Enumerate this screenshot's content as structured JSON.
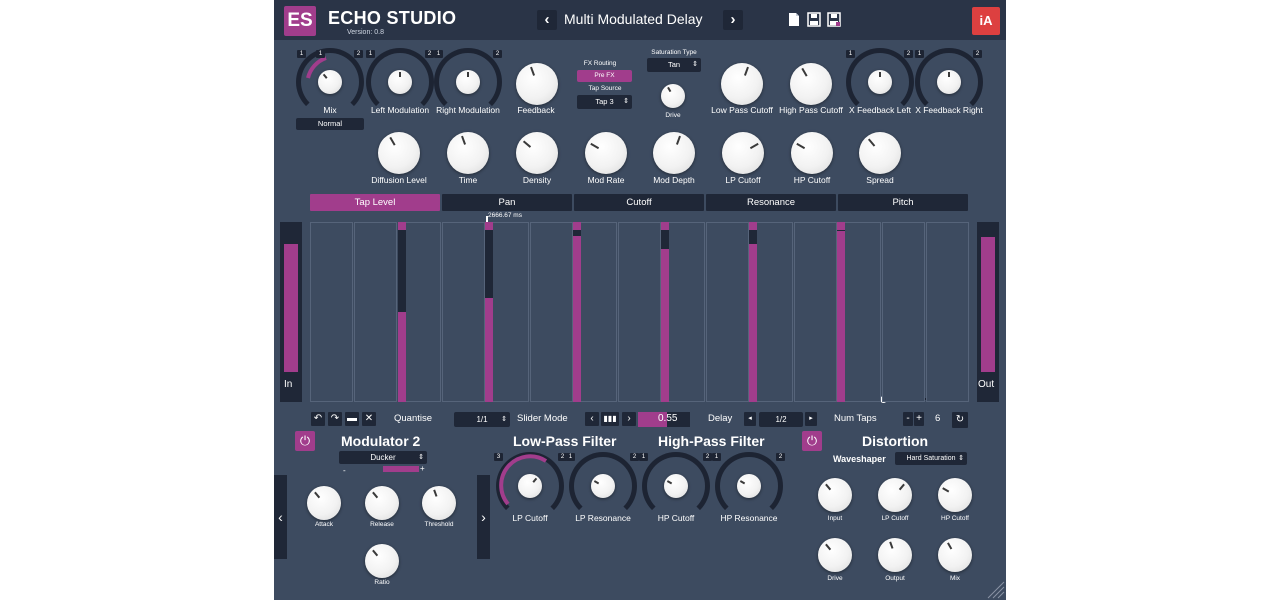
{
  "header": {
    "logo": "ES",
    "title": "ECHO STUDIO",
    "version": "Version: 0.8",
    "preset_name": "Multi Modulated Delay",
    "prev_arrow": "‹",
    "next_arrow": "›",
    "brand": "iA",
    "icons": [
      "new-file-icon",
      "save-icon",
      "save-as-icon"
    ]
  },
  "top_knobs": {
    "mix": {
      "label": "Mix",
      "mode": "Normal",
      "ring_left": "1",
      "ring_mid": "1",
      "ring_right": "2"
    },
    "left_mod": {
      "label": "Left Modulation",
      "ring_left": "1",
      "ring_right": "2"
    },
    "right_mod": {
      "label": "Right Modulation",
      "ring_left": "1",
      "ring_right": "2"
    },
    "feedback": {
      "label": "Feedback"
    },
    "fx_routing": {
      "label": "FX Routing",
      "value": "Pre FX"
    },
    "tap_source": {
      "label": "Tap Source",
      "value": "Tap 3"
    },
    "saturation_type": {
      "label": "Saturation Type",
      "value": "Tan"
    },
    "drive": {
      "label": "Drive"
    },
    "low_pass": {
      "label": "Low Pass Cutoff"
    },
    "high_pass": {
      "label": "High Pass Cutoff"
    },
    "x_fb_left": {
      "label": "X Feedback Left",
      "ring_left": "1",
      "ring_right": "2"
    },
    "x_fb_right": {
      "label": "X Feedback Right",
      "ring_left": "1",
      "ring_right": "2"
    }
  },
  "second_knobs": [
    {
      "label": "Diffusion Level"
    },
    {
      "label": "Time"
    },
    {
      "label": "Density"
    },
    {
      "label": "Mod Rate"
    },
    {
      "label": "Mod Depth"
    },
    {
      "label": "LP Cutoff"
    },
    {
      "label": "HP Cutoff"
    },
    {
      "label": "Spread"
    }
  ],
  "tabs": [
    "Tap Level",
    "Pan",
    "Cutoff",
    "Resonance",
    "Pitch"
  ],
  "active_tab": "Tap Level",
  "grid": {
    "time_readout": "2666.67 ms",
    "in_label": "In",
    "out_label": "Out",
    "in_level": 0.85,
    "out_level": 0.9,
    "taps": [
      {
        "level": 0.5,
        "top_dark": 0.49
      },
      {
        "level": 0.58,
        "top_dark": 0.41
      },
      {
        "level": 0.92,
        "top_dark": 0.07
      },
      {
        "level": 0.85,
        "top_dark": 0.14
      },
      {
        "level": 0.88,
        "top_dark": 0.11
      },
      {
        "level": 0.95,
        "top_dark": 0.04
      }
    ]
  },
  "controls": {
    "quantise_label": "Quantise",
    "quantise_value": "1/1",
    "slider_mode_label": "Slider Mode",
    "slider_value": "0.55",
    "delay_label": "Delay",
    "delay_value": "1/2",
    "num_taps_label": "Num Taps",
    "num_taps_value": "6",
    "minus": "-",
    "plus": "+"
  },
  "modulator": {
    "title": "Modulator 2",
    "mode": "Ducker",
    "knobs": [
      {
        "label": "Attack"
      },
      {
        "label": "Release"
      },
      {
        "label": "Threshold"
      },
      {
        "label": "Ratio"
      }
    ]
  },
  "filters": {
    "lp_title": "Low-Pass Filter",
    "hp_title": "High-Pass Filter",
    "knobs": [
      {
        "label": "LP Cutoff",
        "ring_left": "3",
        "ring_right": "2"
      },
      {
        "label": "LP Resonance",
        "ring_left": "1",
        "ring_right": "2"
      },
      {
        "label": "HP Cutoff",
        "ring_left": "1",
        "ring_right": "2"
      },
      {
        "label": "HP Resonance",
        "ring_left": "1",
        "ring_right": "2"
      }
    ]
  },
  "distortion": {
    "title": "Distortion",
    "waveshaper_label": "Waveshaper",
    "waveshaper_value": "Hard Saturation",
    "knobs": [
      {
        "label": "Input"
      },
      {
        "label": "LP Cutoff"
      },
      {
        "label": "HP Cutoff"
      },
      {
        "label": "Drive"
      },
      {
        "label": "Output"
      },
      {
        "label": "Mix"
      }
    ]
  },
  "colors": {
    "accent": "#a13d8c",
    "panel": "#3d4b60",
    "dark": "#1f2737",
    "header": "#2a3447"
  }
}
